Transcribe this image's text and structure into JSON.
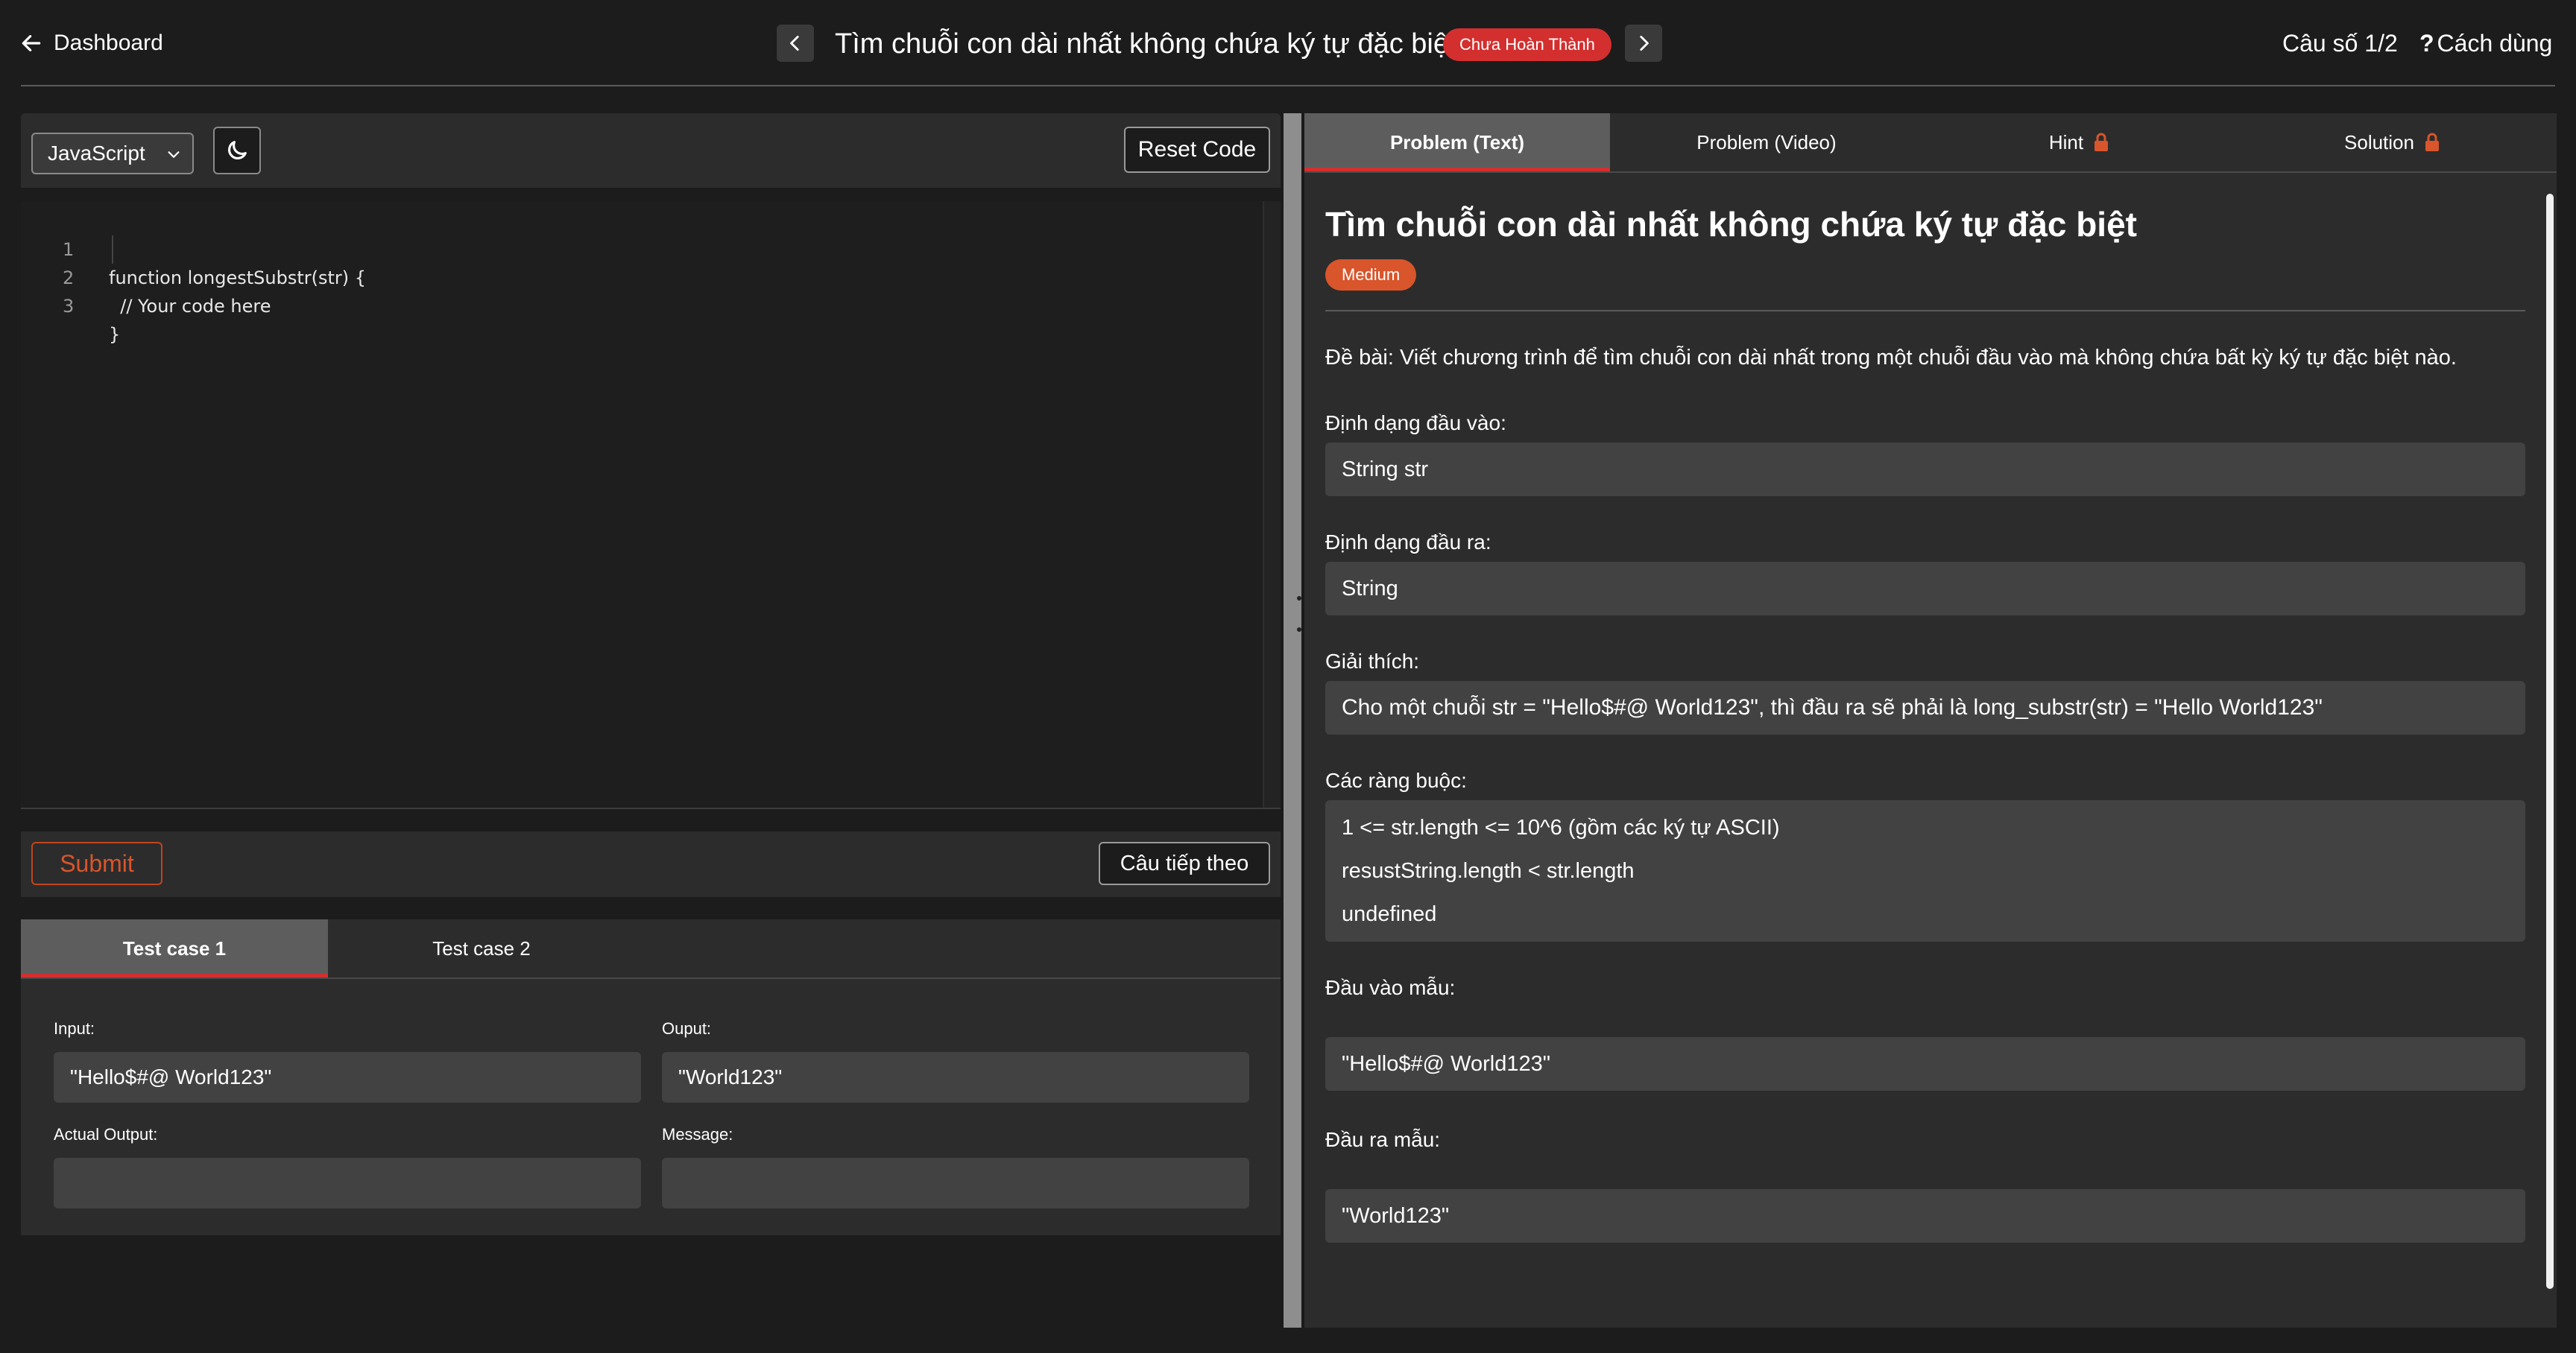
{
  "header": {
    "back_label": "Dashboard",
    "problem_title": "Tìm chuỗi con dài nhất không chứa ký tự đặc biệt",
    "status": "Chưa Hoàn Thành",
    "counter": "Câu số 1/2",
    "help_label": "Cách dùng",
    "help_mark": "?"
  },
  "editor": {
    "language": "JavaScript",
    "reset_label": "Reset Code",
    "lines": [
      {
        "num": "1",
        "code": "function longestSubstr(str) {"
      },
      {
        "num": "2",
        "code": "  // Your code here"
      },
      {
        "num": "3",
        "code": "}"
      }
    ],
    "submit_label": "Submit",
    "next_label": "Câu tiếp theo"
  },
  "testcases": {
    "tabs": [
      "Test case 1",
      "Test case 2"
    ],
    "input_label": "Input:",
    "input_value": "\"Hello$#@ World123\"",
    "output_label": "Ouput:",
    "output_value": "\"World123\"",
    "actual_label": "Actual Output:",
    "actual_value": "",
    "message_label": "Message:",
    "message_value": ""
  },
  "problem": {
    "tabs": [
      "Problem (Text)",
      "Problem (Video)",
      "Hint",
      "Solution"
    ],
    "heading": "Tìm chuỗi con dài nhất không chứa ký tự đặc biệt",
    "difficulty": "Medium",
    "statement": "Đề bài: Viết chương trình để tìm chuỗi con dài nhất trong một chuỗi đầu vào mà không chứa bất kỳ ký tự đặc biệt nào.",
    "input_format_label": "Định dạng đầu vào:",
    "input_format": "String str",
    "output_format_label": "Định dạng đầu ra:",
    "output_format": "String",
    "explanation_label": "Giải thích:",
    "explanation": "Cho một chuỗi str = \"Hello$#@ World123\", thì đầu ra sẽ phải là long_substr(str) = \"Hello World123\"",
    "constraints_label": "Các ràng buộc:",
    "constraints": [
      "1 <= str.length <= 10^6 (gồm các ký tự ASCII)",
      "resustString.length < str.length",
      "undefined"
    ],
    "sample_input_label": "Đầu vào mẫu:",
    "sample_input": "\"Hello$#@ World123\"",
    "sample_output_label": "Đầu ra mẫu:",
    "sample_output": "\"World123\""
  },
  "colors": {
    "accent_red": "#d32f2f",
    "accent_orange": "#d9552b",
    "background": "#1c1c1c",
    "panel": "#2c2c2c"
  }
}
